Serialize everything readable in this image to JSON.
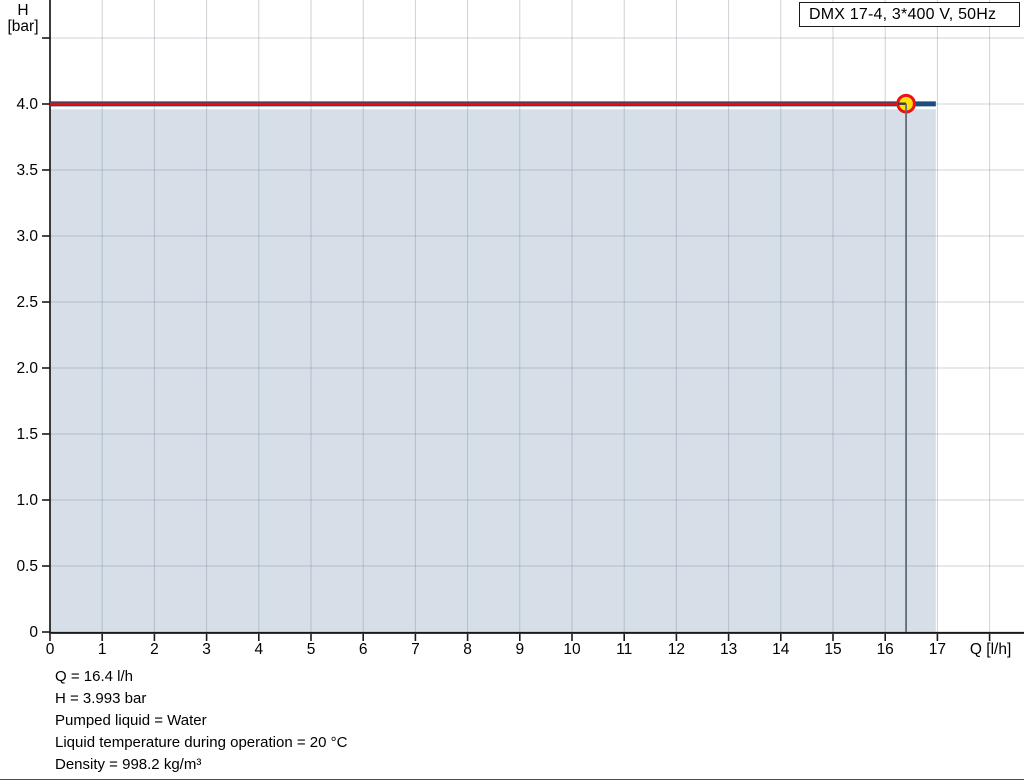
{
  "legend": {
    "label": "DMX 17-4, 3*400 V, 50Hz"
  },
  "info": {
    "lines": [
      "Q = 16.4 l/h",
      "H = 3.993 bar",
      "Pumped liquid = Water",
      "Liquid temperature during operation = 20 °C",
      "Density = 998.2 kg/m³"
    ]
  },
  "chart_data": {
    "type": "line",
    "title": "DMX 17-4, 3*400 V, 50Hz",
    "xlabel": "Q [l/h]",
    "ylabel": "H [bar]",
    "ylabel_lines": [
      "H",
      "[bar]"
    ],
    "xlim": [
      0,
      18.66
    ],
    "ylim": [
      0,
      4.79
    ],
    "grid": true,
    "legend_position": "top-right",
    "x_ticks": [
      {
        "v": 0,
        "label": "0"
      },
      {
        "v": 1,
        "label": "1"
      },
      {
        "v": 2,
        "label": "2"
      },
      {
        "v": 3,
        "label": "3"
      },
      {
        "v": 4,
        "label": "4"
      },
      {
        "v": 5,
        "label": "5"
      },
      {
        "v": 6,
        "label": "6"
      },
      {
        "v": 7,
        "label": "7"
      },
      {
        "v": 8,
        "label": "8"
      },
      {
        "v": 9,
        "label": "9"
      },
      {
        "v": 10,
        "label": "10"
      },
      {
        "v": 11,
        "label": "11"
      },
      {
        "v": 12,
        "label": "12"
      },
      {
        "v": 13,
        "label": "13"
      },
      {
        "v": 14,
        "label": "14"
      },
      {
        "v": 15,
        "label": "15"
      },
      {
        "v": 16,
        "label": "16"
      },
      {
        "v": 17,
        "label": "17"
      },
      {
        "v": 18,
        "label": ""
      }
    ],
    "y_ticks": [
      {
        "v": 0,
        "label": "0"
      },
      {
        "v": 0.5,
        "label": "0.5"
      },
      {
        "v": 1,
        "label": "1.0"
      },
      {
        "v": 1.5,
        "label": "1.5"
      },
      {
        "v": 2,
        "label": "2.0"
      },
      {
        "v": 2.5,
        "label": "2.5"
      },
      {
        "v": 3,
        "label": "3.0"
      },
      {
        "v": 3.5,
        "label": "3.5"
      },
      {
        "v": 4,
        "label": "4.0"
      },
      {
        "v": 4.5,
        "label": ""
      }
    ],
    "series": [
      {
        "name": "pump-curve",
        "color": "#1d4e7e",
        "width": 5,
        "x": [
          0,
          16.97
        ],
        "y": [
          3.99,
          3.99
        ]
      },
      {
        "name": "operating-range",
        "color": "#e01010",
        "width": 2.6,
        "x": [
          0,
          16.4
        ],
        "y": [
          3.99,
          3.99
        ]
      }
    ],
    "area_fill": {
      "color": "#d6dfe8",
      "x": [
        0,
        16.97
      ],
      "y_top": 3.96
    },
    "duty_point": {
      "q": 16.4,
      "h": 3.993,
      "fill": "#ffe20a",
      "stroke": "#ee1111"
    },
    "colors": {
      "axis": "#1a1a1a",
      "grid": "#7d8a96",
      "duty_line": "#5f6b76",
      "marker_inner_tick": "#3a3a3a"
    }
  }
}
